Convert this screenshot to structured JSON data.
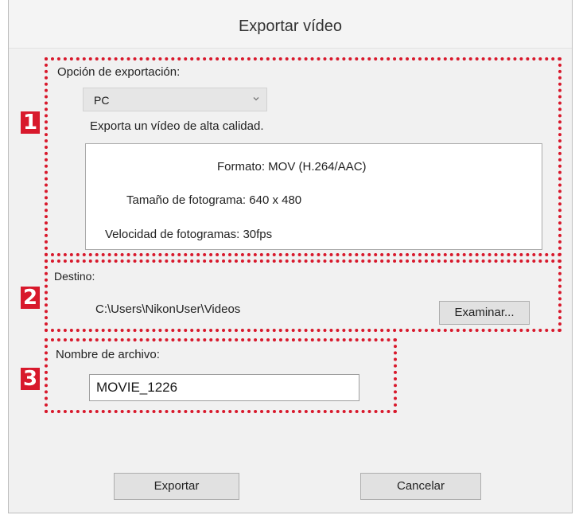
{
  "dialog": {
    "title": "Exportar vídeo"
  },
  "export_option": {
    "label": "Opción de exportación:",
    "selected": "PC",
    "description": "Exporta un vídeo de alta calidad.",
    "format_label": "Formato: MOV (H.264/AAC)",
    "frame_size_label": "Tamaño de fotograma: 640 x 480",
    "frame_rate_label": "Velocidad de fotogramas: 30fps"
  },
  "destination": {
    "label": "Destino:",
    "path": "C:\\Users\\NikonUser\\Videos",
    "browse_label": "Examinar..."
  },
  "filename": {
    "label": "Nombre de archivo:",
    "value": "MOVIE_1226"
  },
  "footer": {
    "export_label": "Exportar",
    "cancel_label": "Cancelar"
  },
  "callouts": {
    "one": "1",
    "two": "2",
    "three": "3"
  },
  "colors": {
    "callout": "#d8192c",
    "dialog_bg": "#f1f1f1"
  }
}
